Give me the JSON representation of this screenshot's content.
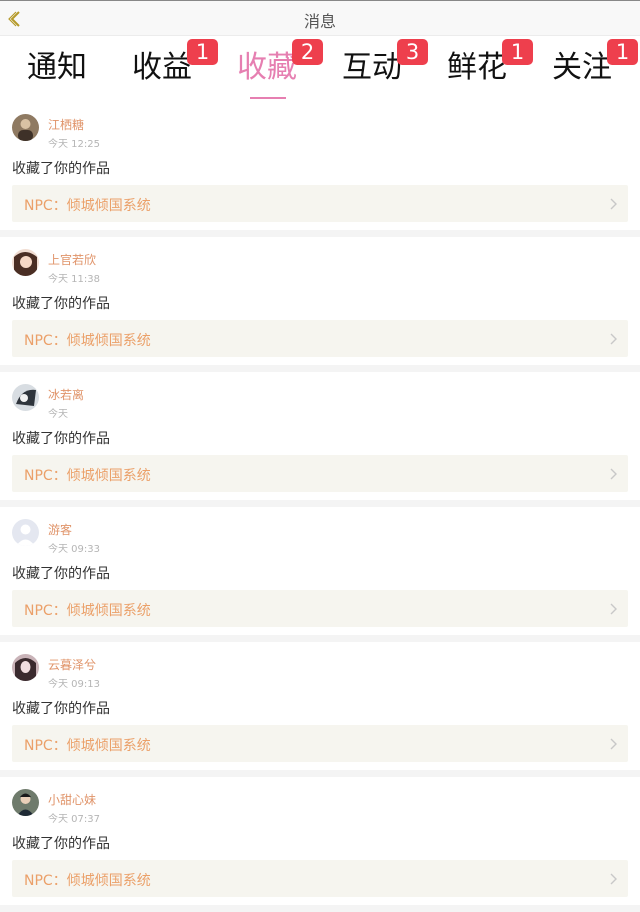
{
  "header": {
    "title": "消息"
  },
  "tabs": [
    {
      "label": "通知",
      "badge": ""
    },
    {
      "label": "收益",
      "badge": "1"
    },
    {
      "label": "收藏",
      "badge": "2"
    },
    {
      "label": "互动",
      "badge": "3"
    },
    {
      "label": "鲜花",
      "badge": "1"
    },
    {
      "label": "关注",
      "badge": "1"
    }
  ],
  "active_tab": "收藏",
  "colors": {
    "accent": "#e67fb1",
    "badge": "#ee3f4d",
    "username": "#e0946a",
    "work_title": "#eba069",
    "work_bg": "#f6f5ef"
  },
  "messages": [
    {
      "user": "江栖糖",
      "time": "今天 12:25",
      "action": "收藏了你的作品",
      "work": "NPC：倾城倾国系统",
      "avatar": "user-avatar-photo"
    },
    {
      "user": "上官若欣",
      "time": "今天 11:38",
      "action": "收藏了你的作品",
      "work": "NPC：倾城倾国系统",
      "avatar": "user-avatar-photo"
    },
    {
      "user": "冰若离",
      "time": "今天",
      "action": "收藏了你的作品",
      "work": "NPC：倾城倾国系统",
      "avatar": "user-avatar-photo"
    },
    {
      "user": "游客",
      "time": "今天 09:33",
      "action": "收藏了你的作品",
      "work": "NPC：倾城倾国系统",
      "avatar": "default-avatar-icon"
    },
    {
      "user": "云暮泽兮",
      "time": "今天 09:13",
      "action": "收藏了你的作品",
      "work": "NPC：倾城倾国系统",
      "avatar": "user-avatar-photo"
    },
    {
      "user": "小甜心妹",
      "time": "今天 07:37",
      "action": "收藏了你的作品",
      "work": "NPC：倾城倾国系统",
      "avatar": "user-avatar-photo"
    }
  ]
}
